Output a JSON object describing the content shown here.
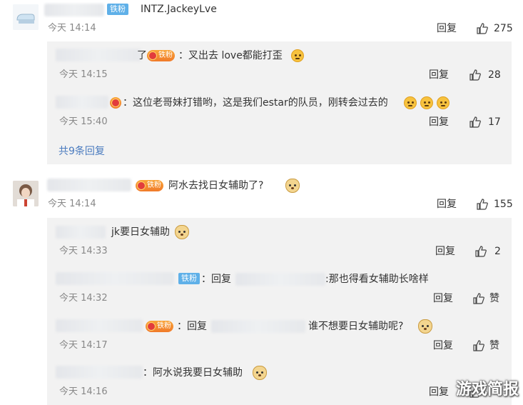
{
  "badges": {
    "iron": "铁粉",
    "fan": "铁粉"
  },
  "comments": [
    {
      "text": "INTZ.JackeyLve",
      "time": "今天 14:14",
      "reply_label": "回复",
      "likes": "275"
    },
    {
      "text": "阿水去找日女辅助了?",
      "time": "今天 14:14",
      "reply_label": "回复",
      "likes": "155"
    }
  ],
  "replies_a": [
    {
      "prefix": "了",
      "text": "：叉出去  love都能打歪",
      "time": "今天 14:15",
      "reply_label": "回复",
      "likes": "28"
    },
    {
      "text": "：这位老哥妹打错哟，这是我们estar的队员，刚转会过去的",
      "time": "今天 15:40",
      "reply_label": "回复",
      "likes": "17"
    }
  ],
  "replies_a_more": "共9条回复",
  "replies_b": [
    {
      "text": "jk要日女辅助",
      "time": "今天 14:33",
      "reply_label": "回复",
      "likes": "2"
    },
    {
      "text_pre": "：回复",
      "text_post": ":那也得看女辅助长啥样",
      "time": "今天 14:32",
      "reply_label": "回复",
      "likes": "赞"
    },
    {
      "text_pre": "：回复",
      "text_post": "谁不想要日女辅助呢?",
      "time": "今天 14:17",
      "reply_label": "回复",
      "likes": "赞"
    },
    {
      "text": "：阿水说我要日女辅助",
      "time": "今天 14:16",
      "reply_label": "回复",
      "likes": ""
    }
  ],
  "watermark": "游戏简报",
  "icons": [
    "avatar",
    "thumb-up-icon",
    "emoji-icon",
    "dog-emoji-icon",
    "fan-badge-icon"
  ],
  "colors": {
    "link": "#4a7bbf",
    "reply_bg": "#f2f2f2",
    "iron_badge": "#5fb0e8"
  }
}
